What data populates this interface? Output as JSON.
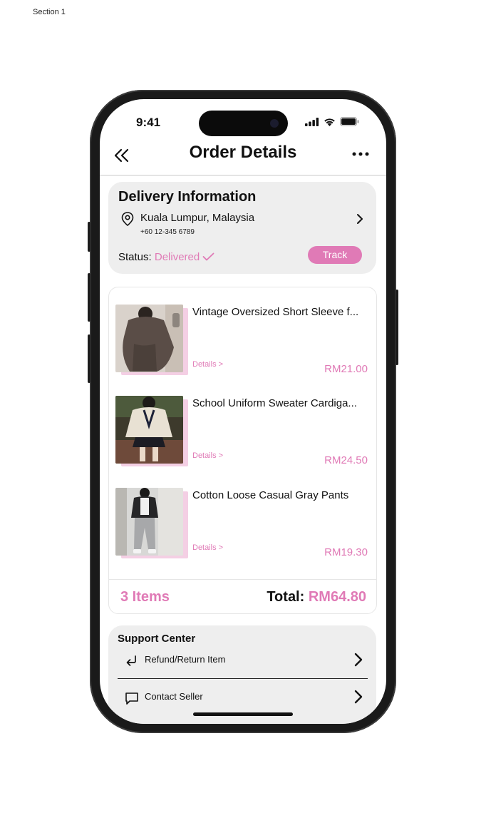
{
  "canvas": {
    "section_label": "Section 1"
  },
  "status_bar": {
    "time": "9:41"
  },
  "nav": {
    "title": "Order Details"
  },
  "delivery": {
    "title": "Delivery Information",
    "city": "Kuala Lumpur, Malaysia",
    "phone": "+60 12-345 6789",
    "status_label": "Status:",
    "status_value": "Delivered",
    "track_label": "Track"
  },
  "items": [
    {
      "name": "Vintage Oversized Short Sleeve f...",
      "details": "Details >",
      "price": "RM21.00"
    },
    {
      "name": "School Uniform Sweater Cardiga...",
      "details": "Details >",
      "price": "RM24.50"
    },
    {
      "name": "Cotton Loose Casual Gray Pants",
      "details": "Details >",
      "price": "RM19.30"
    }
  ],
  "summary": {
    "count": "3 Items",
    "total_label": "Total:",
    "total_value": "RM64.80"
  },
  "support": {
    "title": "Support Center",
    "rows": [
      {
        "label": "Refund/Return Item",
        "icon": "return-arrow-icon"
      },
      {
        "label": "Contact Seller",
        "icon": "chat-bubble-icon"
      }
    ]
  },
  "colors": {
    "accent": "#e07ab6",
    "card_bg": "#eeeeee"
  }
}
